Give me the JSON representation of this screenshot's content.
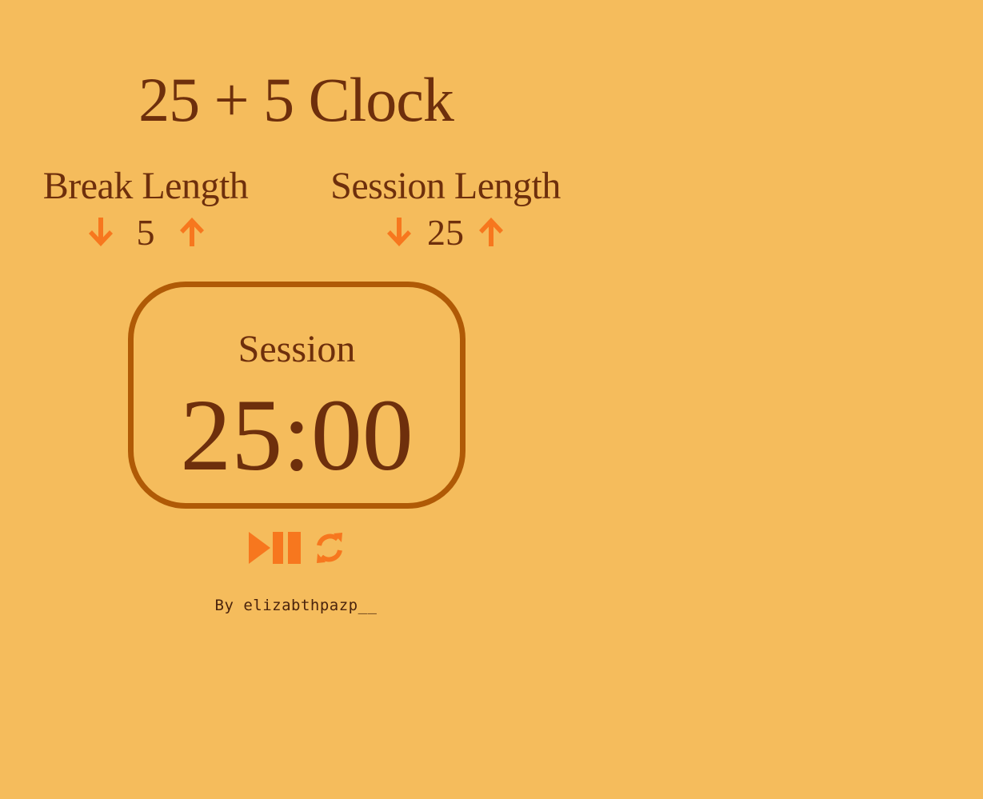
{
  "app": {
    "title": "25 + 5 Clock"
  },
  "break": {
    "label": "Break Length",
    "value": "5",
    "decrement_icon": "arrow-down-icon",
    "increment_icon": "arrow-up-icon"
  },
  "session": {
    "label": "Session Length",
    "value": "25",
    "decrement_icon": "arrow-down-icon",
    "increment_icon": "arrow-up-icon"
  },
  "timer": {
    "label": "Session",
    "time_left": "25:00"
  },
  "player": {
    "start_stop_icon": "play-pause-icon",
    "reset_icon": "refresh-icon"
  },
  "footer": {
    "credit": "By elizabthpazp__"
  },
  "colors": {
    "background": "#f5bc5c",
    "text": "#6e2f0c",
    "accent": "#f7771e",
    "border": "#b05a06"
  }
}
